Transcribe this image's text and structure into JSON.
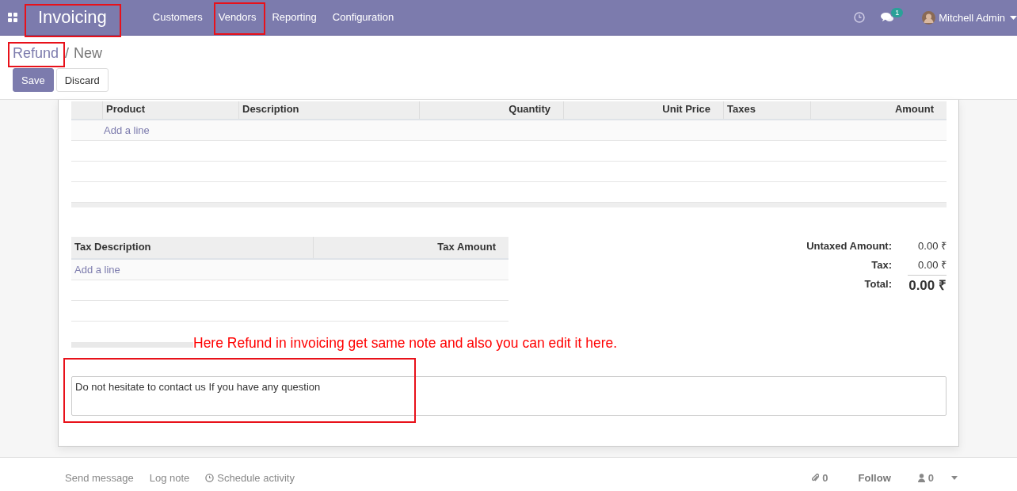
{
  "topbar": {
    "app_title": "Invoicing",
    "menu": [
      {
        "label": "Customers"
      },
      {
        "label": "Vendors"
      },
      {
        "label": "Reporting"
      },
      {
        "label": "Configuration"
      }
    ],
    "message_count": "1",
    "user": "Mitchell Admin"
  },
  "breadcrumb": {
    "parent": "Refund",
    "separator": "/",
    "current": "New"
  },
  "buttons": {
    "save": "Save",
    "discard": "Discard"
  },
  "lines_table": {
    "columns": [
      {
        "label": "Product"
      },
      {
        "label": "Description"
      },
      {
        "label": "Quantity"
      },
      {
        "label": "Unit Price"
      },
      {
        "label": "Taxes"
      },
      {
        "label": "Amount"
      }
    ],
    "add_line": "Add a line"
  },
  "tax_table": {
    "columns": [
      {
        "label": "Tax Description"
      },
      {
        "label": "Tax Amount"
      }
    ],
    "add_line": "Add a line"
  },
  "totals": [
    {
      "label": "Untaxed Amount:",
      "value": "0.00 ₹",
      "kind": "normal"
    },
    {
      "label": "Tax:",
      "value": "0.00 ₹",
      "kind": "normal"
    },
    {
      "label": "Total:",
      "value": "0.00 ₹",
      "kind": "total"
    }
  ],
  "annotation": "Here Refund in invoicing get same note and also you can edit it here.",
  "note": "Do not hesitate to contact us If you have any question",
  "chatter": {
    "send_message": "Send message",
    "log_note": "Log note",
    "schedule_activity": "Schedule activity",
    "attachments": "0",
    "follow": "Follow",
    "followers": "0"
  }
}
